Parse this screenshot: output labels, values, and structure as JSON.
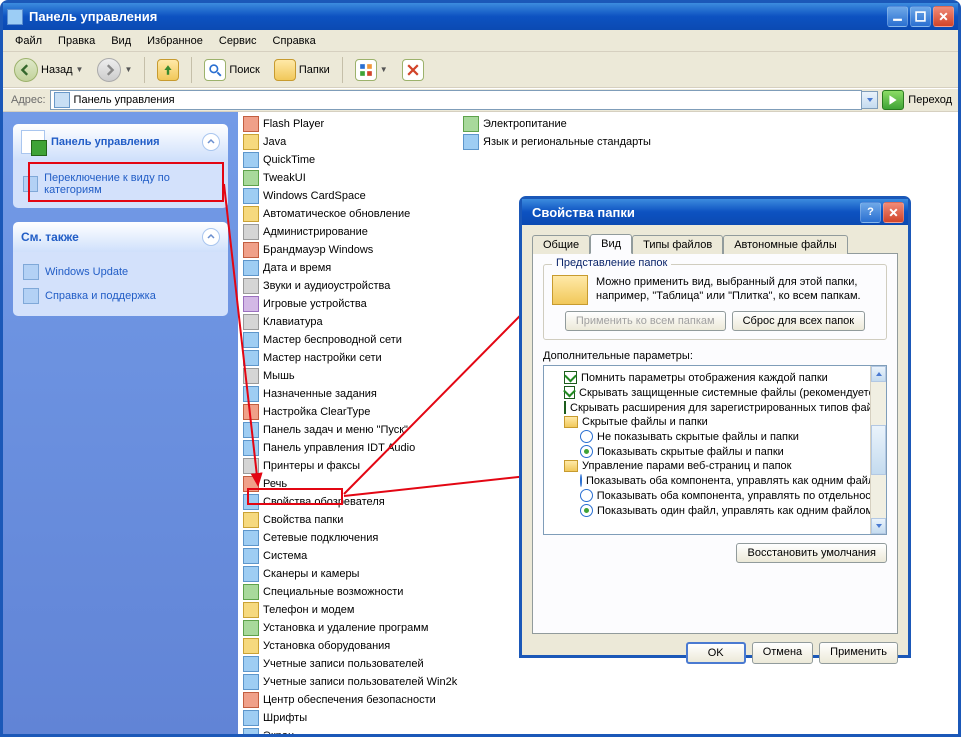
{
  "window": {
    "title": "Панель управления",
    "menu": [
      "Файл",
      "Правка",
      "Вид",
      "Избранное",
      "Сервис",
      "Справка"
    ],
    "toolbar": {
      "back": "Назад",
      "search": "Поиск",
      "folders": "Папки"
    },
    "addrbar": {
      "label": "Адрес:",
      "value": "Панель управления",
      "go": "Переход"
    }
  },
  "sidebar": {
    "panel_title": "Панель управления",
    "switch_link": "Переключение к виду по категориям",
    "see_also_title": "См. также",
    "see_also": [
      "Windows Update",
      "Справка и поддержка"
    ]
  },
  "items_left": [
    {
      "l": "Flash Player",
      "c": "r"
    },
    {
      "l": "Java",
      "c": "y"
    },
    {
      "l": "QuickTime",
      "c": ""
    },
    {
      "l": "TweakUI",
      "c": "g"
    },
    {
      "l": "Windows CardSpace",
      "c": ""
    },
    {
      "l": "Автоматическое обновление",
      "c": "y"
    },
    {
      "l": "Администрирование",
      "c": "gr"
    },
    {
      "l": "Брандмауэр Windows",
      "c": "r"
    },
    {
      "l": "Дата и время",
      "c": ""
    },
    {
      "l": "Звуки и аудиоустройства",
      "c": "gr"
    },
    {
      "l": "Игровые устройства",
      "c": "p"
    },
    {
      "l": "Клавиатура",
      "c": "gr"
    },
    {
      "l": "Мастер беспроводной сети",
      "c": ""
    },
    {
      "l": "Мастер настройки сети",
      "c": ""
    },
    {
      "l": "Мышь",
      "c": "gr"
    },
    {
      "l": "Назначенные задания",
      "c": ""
    },
    {
      "l": "Настройка ClearType",
      "c": "r"
    },
    {
      "l": "Панель задач и меню \"Пуск\"",
      "c": ""
    },
    {
      "l": "Панель управления IDT Audio",
      "c": ""
    },
    {
      "l": "Принтеры и факсы",
      "c": "gr"
    },
    {
      "l": "Речь",
      "c": "r"
    },
    {
      "l": "Свойства обозревателя",
      "c": ""
    },
    {
      "l": "Свойства папки",
      "c": "y"
    },
    {
      "l": "Сетевые подключения",
      "c": ""
    },
    {
      "l": "Система",
      "c": ""
    },
    {
      "l": "Сканеры и камеры",
      "c": ""
    },
    {
      "l": "Специальные возможности",
      "c": "g"
    },
    {
      "l": "Телефон и модем",
      "c": "y"
    },
    {
      "l": "Установка и удаление программ",
      "c": "g"
    },
    {
      "l": "Установка оборудования",
      "c": "y"
    },
    {
      "l": "Учетные записи пользователей",
      "c": ""
    },
    {
      "l": "Учетные записи пользователей Win2k",
      "c": ""
    },
    {
      "l": "Центр обеспечения безопасности",
      "c": "r"
    },
    {
      "l": "Шрифты",
      "c": ""
    },
    {
      "l": "Экран",
      "c": ""
    }
  ],
  "items_right": [
    {
      "l": "Электропитание",
      "c": "g"
    },
    {
      "l": "Язык и региональные стандарты",
      "c": ""
    }
  ],
  "dialog": {
    "title": "Свойства папки",
    "tabs": [
      "Общие",
      "Вид",
      "Типы файлов",
      "Автономные файлы"
    ],
    "group1": {
      "legend": "Представление папок",
      "hint": "Можно применить вид, выбранный для этой папки, например, \"Таблица\" или \"Плитка\", ко всем папкам.",
      "apply": "Применить ко всем папкам",
      "reset": "Сброс для всех папок"
    },
    "adv_label": "Дополнительные параметры:",
    "adv": {
      "i0": "Помнить параметры отображения каждой папки",
      "i1": "Скрывать защищенные системные файлы (рекомендуется)",
      "i2": "Скрывать расширения для зарегистрированных типов файлов",
      "i3": "Скрытые файлы и папки",
      "i4": "Не показывать скрытые файлы и папки",
      "i5": "Показывать скрытые файлы и папки",
      "i6": "Управление парами веб-страниц и папок",
      "i7": "Показывать оба компонента, управлять как одним файлом",
      "i8": "Показывать оба компонента, управлять по отдельности",
      "i9": "Показывать один файл, управлять как одним файлом"
    },
    "restore": "Восстановить умолчания",
    "ok": "OK",
    "cancel": "Отмена",
    "apply_btn": "Применить"
  }
}
